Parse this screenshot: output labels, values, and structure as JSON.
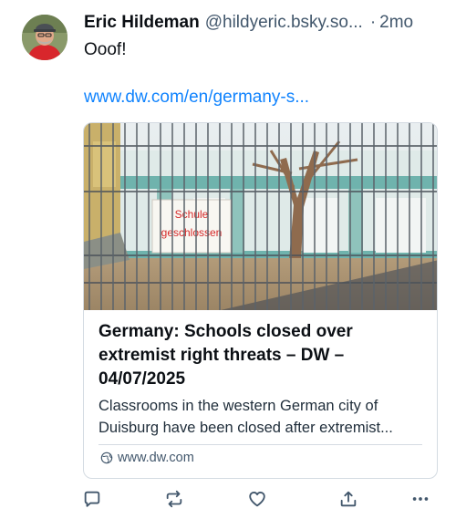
{
  "post": {
    "author_name": "Eric Hildeman",
    "author_handle": "@hildyeric.bsky.so...",
    "separator": "·",
    "timestamp": "2mo",
    "text": "Ooof!",
    "link_text": "www.dw.com/en/germany-s..."
  },
  "embed": {
    "image_sign_lines": [
      "Schule",
      "geschlossen"
    ],
    "title": "Germany: Schools closed over extremist right threats – DW – 04/07/2025",
    "description": "Classrooms in the western German city of Duisburg have been closed after extremist...",
    "domain": "www.dw.com",
    "domain_icon": "globe-icon"
  },
  "actions": {
    "icons": [
      "reply-icon",
      "repost-icon",
      "like-icon",
      "share-icon",
      "more-icon"
    ]
  },
  "colors": {
    "link": "#1083fe",
    "muted": "#42576c",
    "border": "#d4dbe2",
    "sign_text": "#d62a2a"
  }
}
